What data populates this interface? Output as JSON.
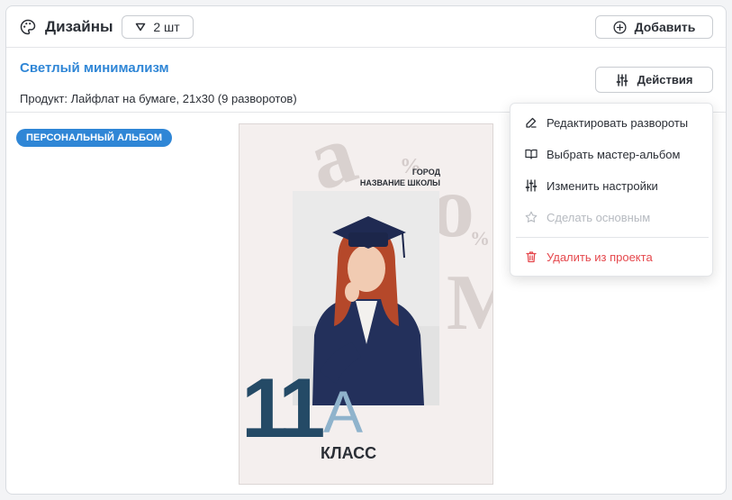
{
  "header": {
    "title": "Дизайны",
    "count_label": "2 шт",
    "add_label": "Добавить"
  },
  "design": {
    "name": "Светлый минимализм",
    "product": "Продукт: Лайфлат на бумаге, 21х30 (9 разворотов)",
    "actions_label": "Действия",
    "badge": "ПЕРСОНАЛЬНЫЙ АЛЬБОМ"
  },
  "cover": {
    "city": "ГОРОД",
    "school": "НАЗВАНИЕ ШКОЛЫ",
    "number": "11",
    "letter": "А",
    "class_word": "КЛАСС"
  },
  "menu": {
    "items": [
      {
        "label": "Редактировать развороты",
        "icon": "edit-icon",
        "enabled": true
      },
      {
        "label": "Выбрать мастер-альбом",
        "icon": "book-icon",
        "enabled": true
      },
      {
        "label": "Изменить настройки",
        "icon": "sliders-icon",
        "enabled": true
      },
      {
        "label": "Сделать основным",
        "icon": "star-icon",
        "enabled": false
      },
      {
        "label": "Удалить из проекта",
        "icon": "trash-icon",
        "enabled": true
      }
    ]
  },
  "colors": {
    "link": "#2f86d6",
    "badge": "#2f86d6",
    "danger": "#e5484d",
    "cover_number": "#244a66",
    "cover_letter": "#8fb3cc"
  }
}
